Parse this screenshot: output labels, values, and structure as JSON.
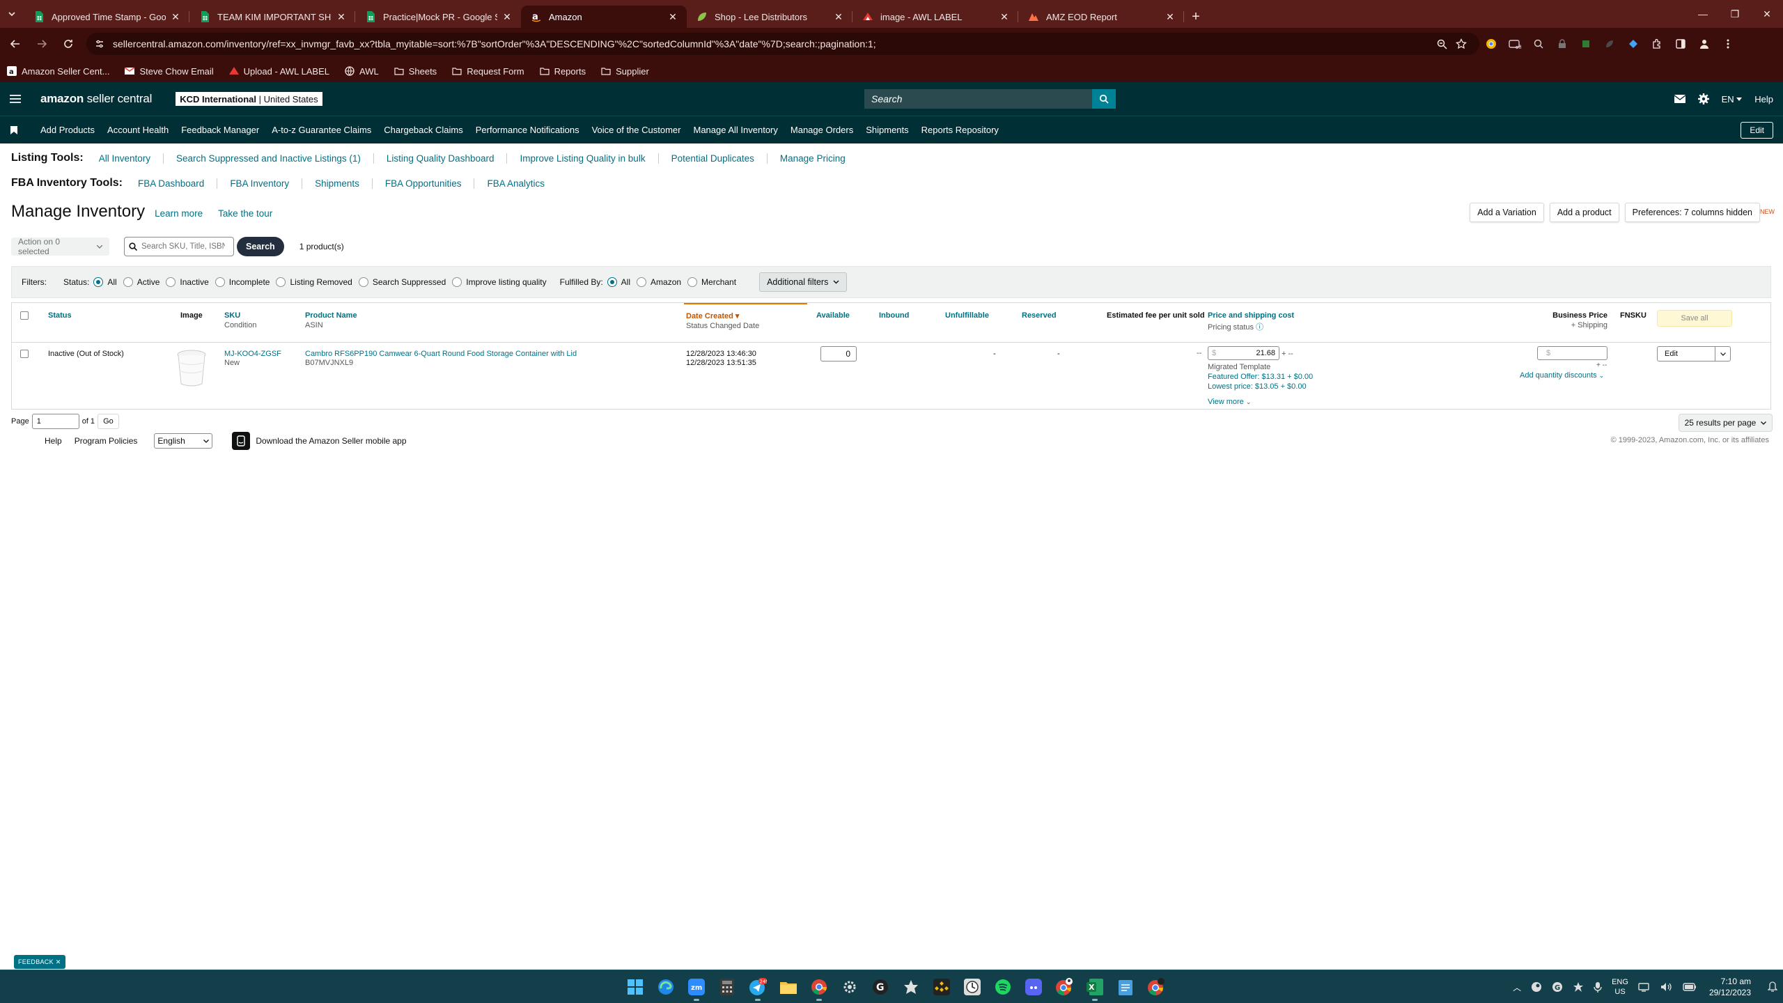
{
  "browser": {
    "tabs": [
      {
        "title": "Approved Time Stamp - Google",
        "icon": "google-sheets-icon",
        "color": "#0f9d58",
        "active": false
      },
      {
        "title": "TEAM KIM IMPORTANT SHEETS",
        "icon": "google-sheets-icon",
        "color": "#0f9d58",
        "active": false
      },
      {
        "title": "Practice|Mock PR - Google Shee",
        "icon": "google-sheets-icon",
        "color": "#0f9d58",
        "active": false
      },
      {
        "title": "Amazon",
        "icon": "amazon-icon",
        "color": "#ffffff",
        "active": true
      },
      {
        "title": "Shop - Lee Distributors",
        "icon": "lee-icon",
        "color": "#8bc34a",
        "active": false
      },
      {
        "title": "image - AWL LABEL",
        "icon": "awl-icon",
        "color": "#e53935",
        "active": false
      },
      {
        "title": "AMZ EOD Report",
        "icon": "amz-eod-icon",
        "color": "#ff7043",
        "active": false
      }
    ],
    "url": "sellercentral.amazon.com/inventory/ref=xx_invmgr_favb_xx?tbla_myitable=sort:%7B\"sortOrder\"%3A\"DESCENDING\"%2C\"sortedColumnId\"%3A\"date\"%7D;search:;pagination:1;",
    "bookmarks": [
      {
        "label": "Amazon Seller Cent...",
        "icon": "amazon-icon"
      },
      {
        "label": "Steve Chow Email",
        "icon": "gmail-icon"
      },
      {
        "label": "Upload - AWL LABEL",
        "icon": "awl-icon"
      },
      {
        "label": "AWL",
        "icon": "globe-icon"
      },
      {
        "label": "Sheets",
        "icon": "folder-icon"
      },
      {
        "label": "Request Form",
        "icon": "folder-icon"
      },
      {
        "label": "Reports",
        "icon": "folder-icon"
      },
      {
        "label": "Supplier",
        "icon": "folder-icon"
      }
    ]
  },
  "amazon": {
    "logo_main": "amazon",
    "logo_sub": "seller central",
    "store_name": "KCD International",
    "store_region": "United States",
    "search_placeholder": "Search",
    "lang": "EN",
    "help": "Help",
    "nav": [
      "Add Products",
      "Account Health",
      "Feedback Manager",
      "A-to-z Guarantee Claims",
      "Chargeback Claims",
      "Performance Notifications",
      "Voice of the Customer",
      "Manage All Inventory",
      "Manage Orders",
      "Shipments",
      "Reports Repository"
    ],
    "edit": "Edit",
    "colors": {
      "header": "#002f36",
      "link": "#007185",
      "accent": "#e77600"
    }
  },
  "listing_tools": {
    "label": "Listing Tools:",
    "links": [
      "All Inventory",
      "Search Suppressed and Inactive Listings (1)",
      "Listing Quality Dashboard",
      "Improve Listing Quality in bulk",
      "Potential Duplicates",
      "Manage Pricing"
    ]
  },
  "fba_tools": {
    "label": "FBA Inventory Tools:",
    "links": [
      "FBA Dashboard",
      "FBA Inventory",
      "Shipments",
      "FBA Opportunities",
      "FBA Analytics"
    ]
  },
  "page": {
    "title": "Manage Inventory",
    "learn_more": "Learn more",
    "tour": "Take the tour",
    "add_variation": "Add a Variation",
    "add_product": "Add a product",
    "preferences": "Preferences: 7 columns hidden",
    "new_badge": "NEW",
    "action_dropdown": "Action on 0 selected",
    "search_placeholder": "Search SKU, Title, ISBN",
    "search_button": "Search",
    "count": "1 product(s)"
  },
  "filters": {
    "label": "Filters:",
    "status_label": "Status:",
    "status_options": [
      "All",
      "Active",
      "Inactive",
      "Incomplete",
      "Listing Removed",
      "Search Suppressed",
      "Improve listing quality"
    ],
    "status_selected": "All",
    "fulfilled_label": "Fulfilled By:",
    "fulfilled_options": [
      "All",
      "Amazon",
      "Merchant"
    ],
    "fulfilled_selected": "All",
    "additional": "Additional filters"
  },
  "table": {
    "headers": {
      "status": "Status",
      "image": "Image",
      "sku": "SKU",
      "condition": "Condition",
      "product_name": "Product Name",
      "asin": "ASIN",
      "date_created": "Date Created",
      "status_changed": "Status Changed Date",
      "available": "Available",
      "inbound": "Inbound",
      "unfulfillable": "Unfulfillable",
      "reserved": "Reserved",
      "est_fee": "Estimated fee per unit sold",
      "price_shipping": "Price and shipping cost",
      "pricing_status": "Pricing status",
      "business_price": "Business Price",
      "plus_shipping": "+ Shipping",
      "fnsku": "FNSKU",
      "save_all": "Save all"
    },
    "rows": [
      {
        "status": "Inactive (Out of Stock)",
        "sku": "MJ-KOO4-ZGSF",
        "condition": "New",
        "product_name": "Cambro RFS6PP190 Camwear 6-Quart Round Food Storage Container with Lid",
        "asin": "B07MVJNXL9",
        "date_created": "12/28/2023 13:46:30",
        "status_changed": "12/28/2023 13:51:35",
        "available": "0",
        "unfulfillable": "-",
        "reserved": "-",
        "est_fee": "--",
        "currency": "$",
        "price": "21.68",
        "plus": "+ --",
        "template": "Migrated Template",
        "featured_offer": "Featured Offer: $13.31 + $0.00",
        "lowest_price": "Lowest price: $13.05 + $0.00",
        "view_more": "View more",
        "business_currency": "$",
        "business_plus": "+ --",
        "add_qty_discounts": "Add quantity discounts",
        "edit": "Edit"
      }
    ]
  },
  "pagination": {
    "page_label": "Page",
    "page": "1",
    "of": "of 1",
    "go": "Go",
    "per_page": "25 results per page"
  },
  "footer": {
    "help": "Help",
    "policies": "Program Policies",
    "language": "English",
    "app": "Download the Amazon Seller mobile app",
    "copyright": "© 1999-2023, Amazon.com, Inc. or its affiliates"
  },
  "feedback": "FEEDBACK",
  "taskbar": {
    "lang_top": "ENG",
    "lang_bottom": "US",
    "time": "7:10 am",
    "date": "29/12/2023",
    "badge": "249"
  }
}
